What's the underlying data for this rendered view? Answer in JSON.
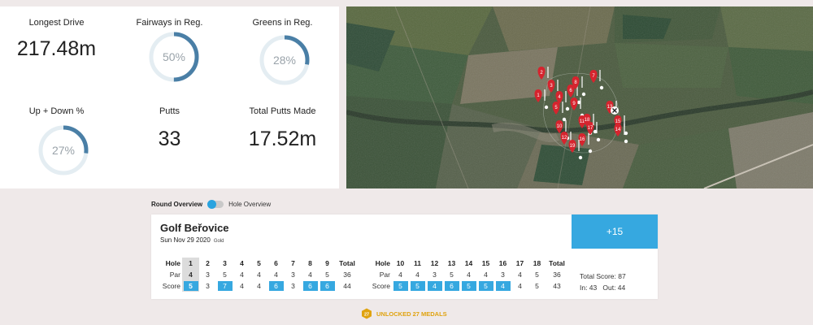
{
  "stats": {
    "longest_drive": {
      "label": "Longest Drive",
      "value": "217.48m"
    },
    "fairways": {
      "label": "Fairways in Reg.",
      "value": "50%",
      "fraction": 0.5
    },
    "greens": {
      "label": "Greens in Reg.",
      "value": "28%",
      "fraction": 0.28
    },
    "up_down": {
      "label": "Up + Down %",
      "value": "27%",
      "fraction": 0.27
    },
    "putts": {
      "label": "Putts",
      "value": "33"
    },
    "total_putts": {
      "label": "Total Putts Made",
      "value": "17.52m"
    }
  },
  "colors": {
    "accent": "#36a8e0",
    "ring_fill": "#4a7fa6",
    "ring_track": "#e4edf2",
    "medal": "#e0a30f"
  },
  "map": {
    "close_icon": "close-icon",
    "pins": [
      "1",
      "2",
      "3",
      "4",
      "5",
      "6",
      "7",
      "8",
      "9",
      "10",
      "11",
      "12",
      "13",
      "14",
      "15",
      "16",
      "17",
      "18",
      "19"
    ]
  },
  "toggle": {
    "active": "Round Overview",
    "inactive": "Hole Overview"
  },
  "scorecard": {
    "course": "Golf Beřovice",
    "date": "Sun Nov 29 2020",
    "tier": "Gold",
    "relative_score": "+15",
    "labels": {
      "hole": "Hole",
      "par": "Par",
      "score": "Score",
      "total": "Total"
    },
    "front": {
      "holes": [
        "1",
        "2",
        "3",
        "4",
        "5",
        "6",
        "7",
        "8",
        "9"
      ],
      "par": [
        "4",
        "3",
        "5",
        "4",
        "4",
        "4",
        "3",
        "4",
        "5"
      ],
      "score": [
        "5",
        "3",
        "7",
        "4",
        "4",
        "6",
        "3",
        "6",
        "6"
      ],
      "total_par": "36",
      "total_score": "44"
    },
    "back": {
      "holes": [
        "10",
        "11",
        "12",
        "13",
        "14",
        "15",
        "16",
        "17",
        "18"
      ],
      "par": [
        "4",
        "4",
        "3",
        "5",
        "4",
        "4",
        "3",
        "4",
        "5"
      ],
      "score": [
        "5",
        "5",
        "4",
        "6",
        "5",
        "5",
        "4",
        "4",
        "5"
      ],
      "total_par": "36",
      "total_score": "43"
    },
    "summary": {
      "total": "Total Score: 87",
      "in": "In: 43",
      "out": "Out: 44"
    }
  },
  "medals": {
    "label": "UNLOCKED 27 MEDALS",
    "icon": "medal-hex-icon",
    "badge": "27"
  }
}
